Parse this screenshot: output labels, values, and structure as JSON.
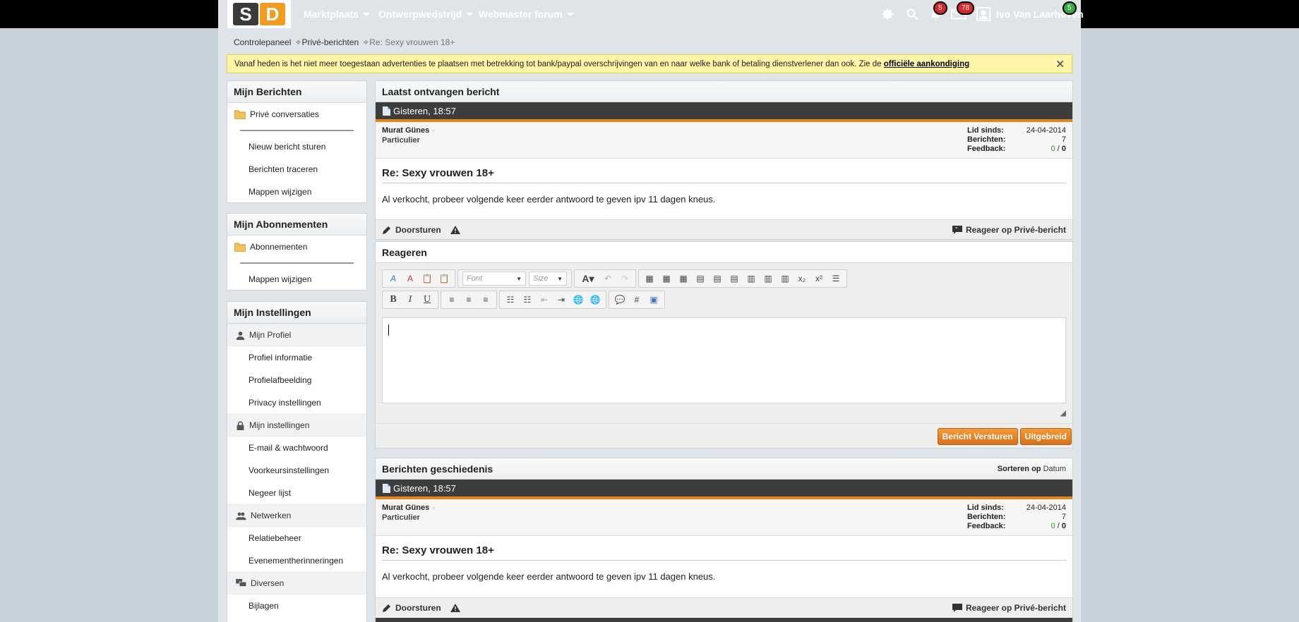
{
  "logo": {
    "s": "S",
    "d": "D"
  },
  "nav": [
    {
      "label": "Marktplaats"
    },
    {
      "label": "Ontwerpwedstrijd"
    },
    {
      "label": "Webmaster forum"
    }
  ],
  "topright": {
    "notifications_count": "5",
    "messages_count": "78",
    "user_name": "Ivo Van Laarhoven",
    "user_badge": "5"
  },
  "breadcrumb": {
    "home": "Controlepaneel",
    "section": "Privé-berichten",
    "current": "Re: Sexy vrouwen 18+"
  },
  "notice": {
    "text": "Vanaf heden is het niet meer toegestaan advertenties te plaatsen met betrekking tot bank/paypal overschrijvingen van en naar welke bank of betaling dienstverlener dan ook. Zie de ",
    "link": "officiële aankondiging",
    "close": "✕"
  },
  "sidebar": {
    "berichten": {
      "title": "Mijn Berichten",
      "folder": "Privé conversaties",
      "items": [
        "Nieuw bericht sturen",
        "Berichten traceren",
        "Mappen wijzigen"
      ]
    },
    "abonnementen": {
      "title": "Mijn Abonnementen",
      "folder": "Abonnementen",
      "items": [
        "Mappen wijzigen"
      ]
    },
    "instellingen": {
      "title": "Mijn Instellingen",
      "groups": [
        {
          "label": "Mijn Profiel",
          "items": [
            "Profiel informatie",
            "Profielafbeelding",
            "Privacy instellingen"
          ]
        },
        {
          "label": "Mijn instellingen",
          "items": [
            "E-mail & wachtwoord",
            "Voorkeursinstellingen",
            "Negeer lijst"
          ]
        },
        {
          "label": "Netwerken",
          "items": [
            "Relatiebeheer",
            "Evenementherinneringen"
          ]
        },
        {
          "label": "Diversen",
          "items": [
            "Bijlagen"
          ]
        }
      ]
    }
  },
  "latest": {
    "title": "Laatst ontvangen bericht",
    "date": "Gisteren, 18:57",
    "sender": "Murat Günes",
    "sender_type": "Particulier",
    "meta": {
      "lid_label": "Lid sinds:",
      "lid_value": "24-04-2014",
      "berichten_label": "Berichten:",
      "berichten_value": "7",
      "feedback_label": "Feedback:",
      "feedback_pos": "0",
      "feedback_sep": " / ",
      "feedback_neg": "0"
    },
    "subject": "Re: Sexy vrouwen 18+",
    "body": "Al verkocht, probeer volgende keer eerder antwoord te geven ipv 11 dagen kneus.",
    "forward": "Doorsturen",
    "reply": "Reageer op Privé-bericht"
  },
  "reply": {
    "title": "Reageren",
    "font_placeholder": "Font",
    "size_placeholder": "Size",
    "send": "Bericht Versturen",
    "advanced": "Uitgebreid"
  },
  "history": {
    "title": "Berichten geschiedenis",
    "sort_label": "Sorteren",
    "sort_op": "op",
    "sort_value": "Datum",
    "date": "Gisteren, 18:57",
    "sender": "Murat Günes",
    "sender_type": "Particulier",
    "meta": {
      "lid_label": "Lid sinds:",
      "lid_value": "24-04-2014",
      "berichten_label": "Berichten:",
      "berichten_value": "7",
      "feedback_label": "Feedback:",
      "feedback_pos": "0",
      "feedback_sep": " / ",
      "feedback_neg": "0"
    },
    "subject": "Re: Sexy vrouwen 18+",
    "body": "Al verkocht, probeer volgende keer eerder antwoord te geven ipv 11 dagen kneus.",
    "forward": "Doorsturen",
    "reply": "Reageer op Privé-bericht"
  }
}
